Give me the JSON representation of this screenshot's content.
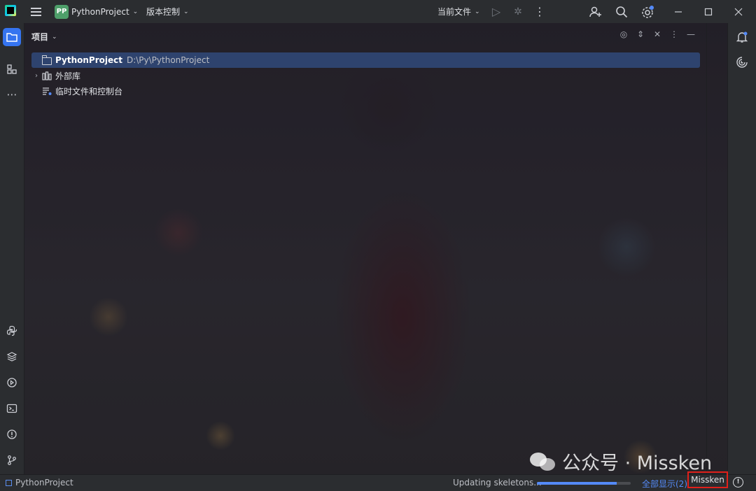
{
  "titlebar": {
    "project_badge": "PP",
    "project_name": "PythonProject",
    "vcs_label": "版本控制",
    "run_config": "当前文件",
    "icons": [
      "hamburger-menu-icon",
      "run-icon",
      "debug-icon",
      "more-icon",
      "add-user-icon",
      "search-icon",
      "settings-icon",
      "minimize-icon",
      "maximize-icon",
      "close-icon"
    ]
  },
  "left_toolbar": {
    "top": [
      "project-folder-icon",
      "structure-icon",
      "more-icon"
    ],
    "bottom": [
      "python-console-icon",
      "layers-icon",
      "services-icon",
      "terminal-icon",
      "problems-icon",
      "git-icon"
    ]
  },
  "right_toolbar": [
    "notifications-icon",
    "ai-assistant-icon"
  ],
  "project_panel": {
    "title": "项目",
    "tree": [
      {
        "name": "PythonProject",
        "path": "D:\\Py\\PythonProject",
        "selected": true
      },
      {
        "label": "外部库",
        "expandable": true
      },
      {
        "label": "临时文件和控制台"
      }
    ]
  },
  "watermark": {
    "text": "公众号 · Missken"
  },
  "statusbar": {
    "project": "PythonProject",
    "task": "Updating skeletons...",
    "progress": 0.85,
    "show_all": "全部显示(2)",
    "user": "Missken"
  },
  "colors": {
    "accent": "#3574f0",
    "selection": "#2e436e",
    "highlight_box": "#e0201a",
    "badge": "#4e9f6a"
  }
}
